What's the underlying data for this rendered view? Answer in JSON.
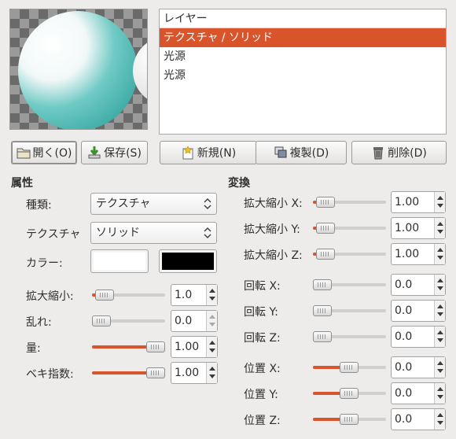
{
  "layers": {
    "header": "レイヤー",
    "items": [
      "テクスチャ / ソリッド",
      "光源",
      "光源"
    ]
  },
  "buttons": {
    "open": "開く(O)",
    "save": "保存(S)",
    "new": "新規(N)",
    "duplicate": "複製(D)",
    "delete": "削除(D)"
  },
  "properties": {
    "title": "属性",
    "type_label": "種類:",
    "type_value": "テクスチャ",
    "texture_label": "テクスチャ",
    "texture_value": "ソリッド",
    "color_label": "カラー:",
    "color1": "#ffffff",
    "color2": "#000000",
    "scale_label": "拡大縮小:",
    "scale_value": "1.0",
    "turbulence_label": "乱れ:",
    "turbulence_value": "0.0",
    "amount_label": "量:",
    "amount_value": "1.00",
    "exponent_label": "ベキ指数:",
    "exponent_value": "1.00"
  },
  "transform": {
    "title": "変換",
    "scale_x_label": "拡大縮小 X:",
    "scale_x_value": "1.00",
    "scale_y_label": "拡大縮小 Y:",
    "scale_y_value": "1.00",
    "scale_z_label": "拡大縮小 Z:",
    "scale_z_value": "1.00",
    "rotate_x_label": "回転 X:",
    "rotate_x_value": "0.0",
    "rotate_y_label": "回転 Y:",
    "rotate_y_value": "0.0",
    "rotate_z_label": "回転 Z:",
    "rotate_z_value": "0.0",
    "position_x_label": "位置 X:",
    "position_x_value": "0.0",
    "position_y_label": "位置 Y:",
    "position_y_value": "0.0",
    "position_z_label": "位置 Z:",
    "position_z_value": "0.0"
  },
  "colors": {
    "accent": "#d9542a",
    "selected_row": "#d9542a",
    "sphere": "#4bbdb6"
  }
}
